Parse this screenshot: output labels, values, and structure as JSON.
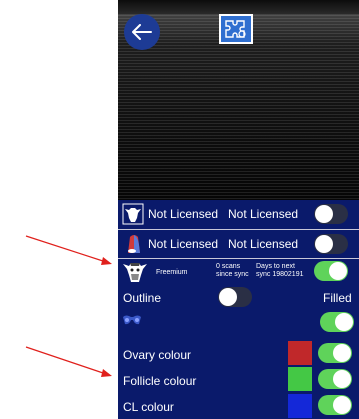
{
  "rows": {
    "license1": {
      "label1": "Not Licensed",
      "label2": "Not Licensed",
      "toggle": false
    },
    "license2": {
      "label1": "Not Licensed",
      "label2": "Not Licensed",
      "toggle": false
    },
    "sync": {
      "plan": "Freemium",
      "scans_line1": "0 scans",
      "scans_line2": "since sync",
      "days_line1": "Days to next",
      "days_line2": "sync 19802191",
      "toggle": true
    },
    "outline": {
      "left_label": "Outline",
      "right_label": "Filled",
      "toggle": false
    },
    "probe": {
      "toggle": true
    },
    "ovary": {
      "label": "Ovary colour",
      "swatch": "#c0282a",
      "toggle": true
    },
    "follicle": {
      "label": "Follicle colour",
      "swatch": "#44c845",
      "toggle": true
    },
    "cl": {
      "label": "CL colour",
      "swatch": "#1428d8",
      "toggle": true
    }
  },
  "colors": {
    "panel": "#0a1a6b",
    "toggle_on": "#5fd35a",
    "toggle_off": "#2a2f45",
    "arrow": "#e0201c"
  },
  "icons": {
    "back": "arrow-left-icon",
    "puzzle": "puzzle-icon",
    "cow_frame": "cow-head-frame-icon",
    "probe_color": "colored-probe-icon",
    "cow_bw": "cow-head-icon",
    "goggles": "goggles-icon"
  }
}
